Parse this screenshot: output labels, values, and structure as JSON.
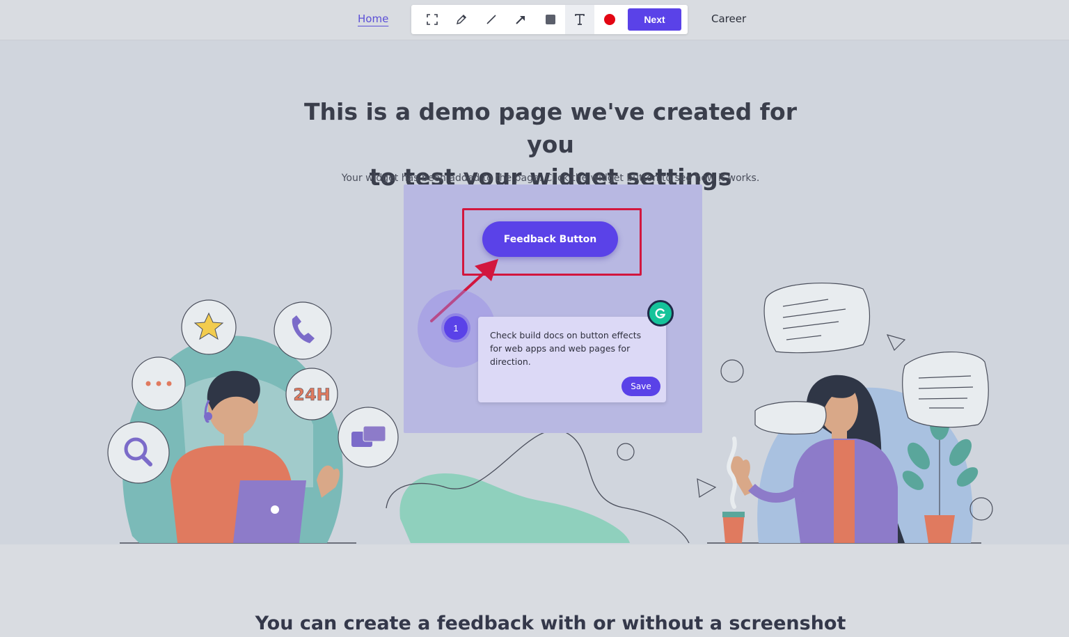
{
  "nav": {
    "home_label": "Home",
    "career_label": "Career"
  },
  "toolbar": {
    "tools": [
      {
        "icon": "crop-select-icon"
      },
      {
        "icon": "pen-icon"
      },
      {
        "icon": "line-icon"
      },
      {
        "icon": "arrow-icon"
      },
      {
        "icon": "rectangle-icon"
      },
      {
        "icon": "text-icon",
        "active": true
      },
      {
        "icon": "color-picker-icon",
        "color": "#e30613"
      }
    ],
    "next_label": "Next"
  },
  "hero": {
    "headline_line1": "This is a demo page we've created for you",
    "headline_line2": "to test your widget settings",
    "subline": "Your widget has been added to the page. Click the widget button to see how it works."
  },
  "widget": {
    "feedback_button_label": "Feedback Button",
    "annotation_color": "#d2163e",
    "pin_number": "1",
    "comment_text": "Check build docs on button effects for web apps and web pages for direction.",
    "save_label": "Save"
  },
  "illustration": {
    "badge_text": "24H"
  },
  "section2": {
    "title": "You can create a feedback with or without a screenshot"
  },
  "colors": {
    "accent": "#5a42e8",
    "annotation": "#d2163e",
    "hero_bg": "#d0d5dd"
  }
}
